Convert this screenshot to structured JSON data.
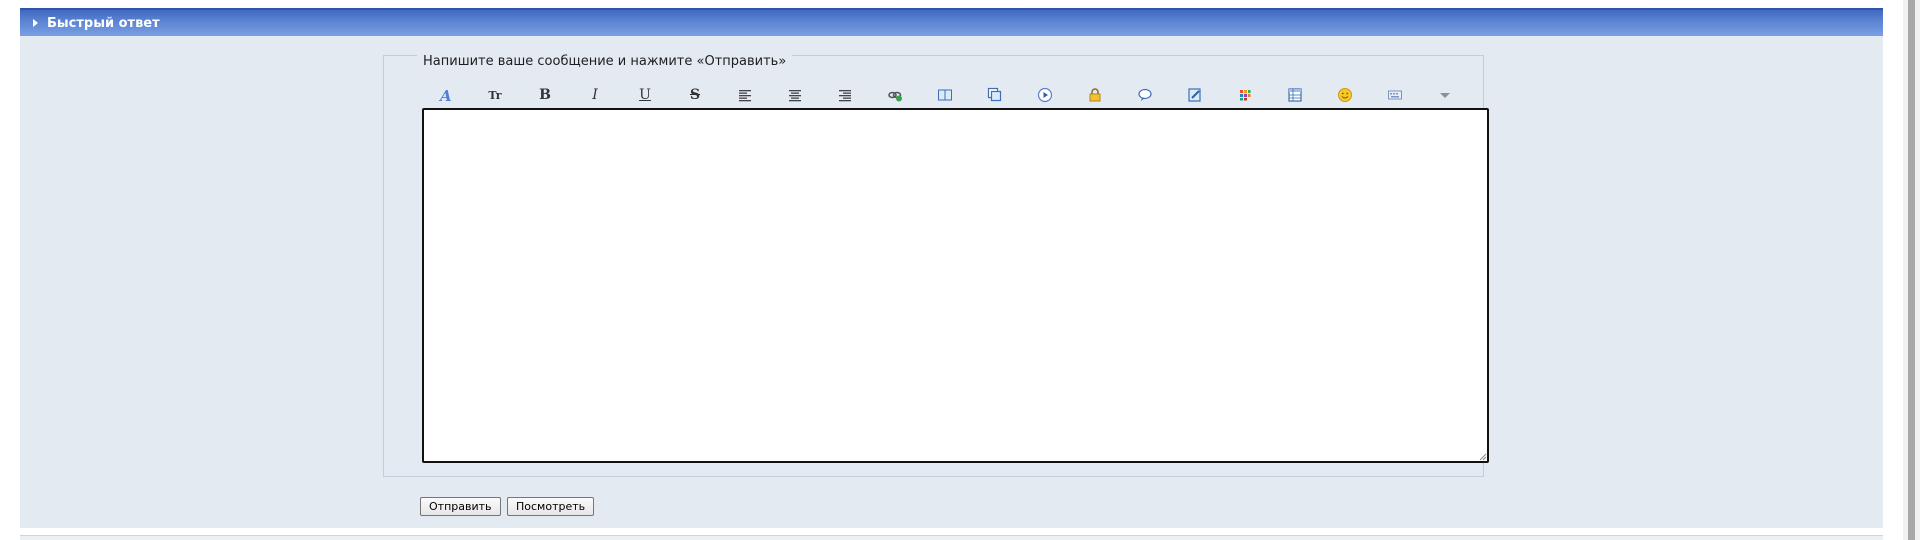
{
  "panel": {
    "title": "Быстрый ответ"
  },
  "form": {
    "legend": "Напишите ваше сообщение и нажмите «Отправить»",
    "message_value": "",
    "submit_label": "Отправить",
    "preview_label": "Посмотреть"
  },
  "toolbar": {
    "items": [
      {
        "name": "font-icon"
      },
      {
        "name": "font-size-icon",
        "text": "Tr"
      },
      {
        "name": "bold-icon",
        "text": "B"
      },
      {
        "name": "italic-icon",
        "text": "I"
      },
      {
        "name": "underline-icon",
        "text": "U"
      },
      {
        "name": "strikethrough-icon",
        "text": "S"
      },
      {
        "name": "align-left-icon"
      },
      {
        "name": "align-center-icon"
      },
      {
        "name": "align-right-icon"
      },
      {
        "name": "link-icon"
      },
      {
        "name": "book-icon"
      },
      {
        "name": "copy-icon"
      },
      {
        "name": "play-icon"
      },
      {
        "name": "lock-icon"
      },
      {
        "name": "speech-bubble-icon"
      },
      {
        "name": "edit-icon"
      },
      {
        "name": "color-palette-icon"
      },
      {
        "name": "table-icon"
      },
      {
        "name": "smiley-icon"
      },
      {
        "name": "keyboard-icon"
      },
      {
        "name": "dropdown-arrow-icon"
      }
    ]
  },
  "colors": {
    "header_blue": "#4a75c9",
    "panel_bg": "#e4eaf2"
  }
}
